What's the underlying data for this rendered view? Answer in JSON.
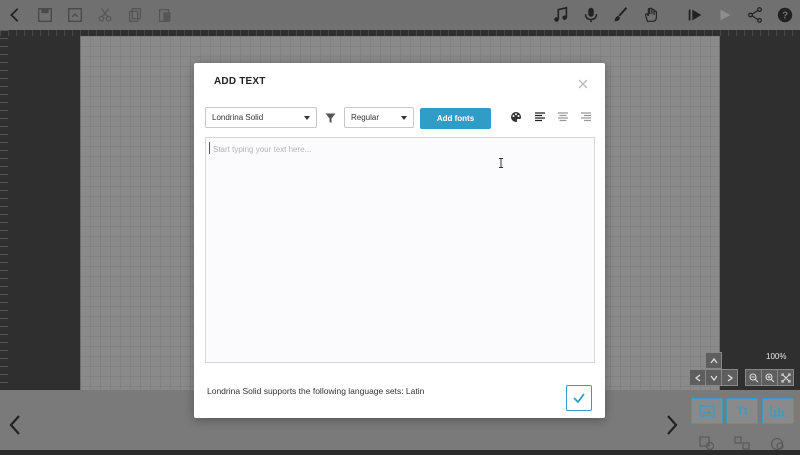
{
  "toolbar": {
    "icons": [
      "back-icon",
      "save-icon",
      "save-as-icon",
      "cut-icon",
      "copy-icon",
      "paste-icon",
      "music-icon",
      "microphone-icon",
      "brush-icon",
      "hand-icon",
      "play-from-start-icon",
      "play-icon",
      "share-icon",
      "help-icon"
    ]
  },
  "zoom": {
    "level": "100%"
  },
  "bottom_buttons": {
    "text_label": "Tt"
  },
  "dialog": {
    "title": "ADD TEXT",
    "font_select": {
      "value": "Londrina Solid"
    },
    "style_select": {
      "value": "Regular"
    },
    "add_fonts_label": "Add fonts",
    "text_input": {
      "placeholder": "Start typing your text here...",
      "value": ""
    },
    "language_note": "Londrina Solid supports the following language sets: Latin"
  },
  "colors": {
    "accent": "#2f9dc6",
    "topbar": "#707070",
    "stage": "#8a8a8a"
  }
}
